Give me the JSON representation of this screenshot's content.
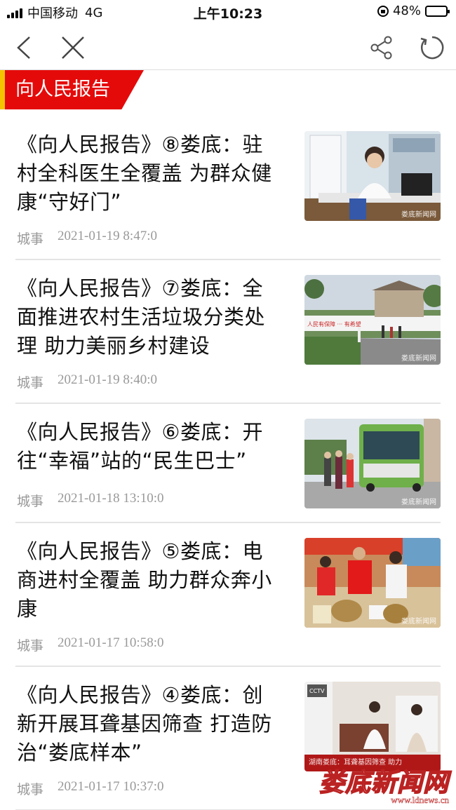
{
  "status_bar": {
    "carrier": "中国移动",
    "network": "4G",
    "time": "上午10:23",
    "battery": "48%",
    "battery_level": 0.48
  },
  "nav": {
    "back_icon": "chevron-left-icon",
    "close_icon": "close-icon",
    "share_icon": "share-icon",
    "refresh_icon": "refresh-icon"
  },
  "section": {
    "title": "向人民报告",
    "accent_color": "#e50a0a",
    "stripe_color": "#f5c400"
  },
  "articles": [
    {
      "title": "《向人民报告》⑧娄底：驻村全科医生全覆盖 为群众健康“守好门”",
      "category": "城事",
      "date": "2021-01-19 8:47:0",
      "watermark": "娄底新闻网"
    },
    {
      "title": "《向人民报告》⑦娄底：全面推进农村生活垃圾分类处理 助力美丽乡村建设",
      "category": "城事",
      "date": "2021-01-19 8:40:0",
      "watermark": "娄底新闻网"
    },
    {
      "title": "《向人民报告》⑥娄底：开往“幸福”站的“民生巴士”",
      "category": "城事",
      "date": "2021-01-18 13:10:0",
      "watermark": "娄底新闻网"
    },
    {
      "title": "《向人民报告》⑤娄底：电商进村全覆盖 助力群众奔小康",
      "category": "城事",
      "date": "2021-01-17 10:58:0",
      "watermark": "娄底新闻网"
    },
    {
      "title": "《向人民报告》④娄底：创新开展耳聋基因筛查 打造防治“娄底样本”",
      "category": "城事",
      "date": "2021-01-17 10:37:0",
      "watermark": "湖南娄底：耳聋基因筛查 助力"
    }
  ],
  "footer_watermark": {
    "name": "娄底新闻网",
    "url": "www.ldnews.cn"
  }
}
